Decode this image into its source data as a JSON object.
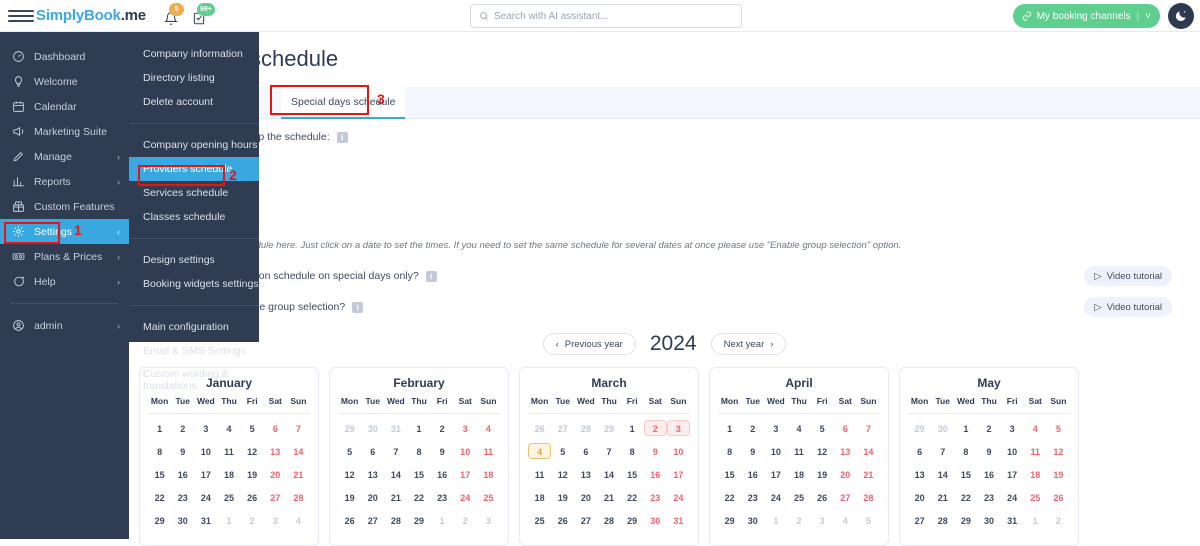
{
  "header": {
    "logo_simply": "S",
    "logo_mid": "implyBook",
    "logo_end": ".me",
    "menu_icon": "hamburger-icon",
    "bell_badge": "5",
    "tasks_badge": "99+",
    "search": {
      "placeholder": "Search with AI assistant...",
      "value": ""
    },
    "booking_channels_label": "My booking channels",
    "booking_channels_caret": "˅",
    "theme_toggle": "dark-mode-icon"
  },
  "sidebar": {
    "items": [
      {
        "label": "Dashboard",
        "icon": "dashboard-icon",
        "chevron": "",
        "active": false
      },
      {
        "label": "Welcome",
        "icon": "bulb-icon",
        "chevron": "",
        "active": false
      },
      {
        "label": "Calendar",
        "icon": "calendar-icon",
        "chevron": "",
        "active": false
      },
      {
        "label": "Marketing Suite",
        "icon": "megaphone-icon",
        "chevron": "",
        "active": false
      },
      {
        "label": "Manage",
        "icon": "pencil-icon",
        "chevron": "›",
        "active": false
      },
      {
        "label": "Reports",
        "icon": "chart-icon",
        "chevron": "›",
        "active": false
      },
      {
        "label": "Custom Features",
        "icon": "gift-icon",
        "chevron": "",
        "active": false
      },
      {
        "label": "Settings",
        "icon": "gear-icon",
        "chevron": "‹",
        "active": true
      },
      {
        "label": "Plans & Prices",
        "icon": "money-icon",
        "chevron": "›",
        "active": false
      },
      {
        "label": "Help",
        "icon": "chat-icon",
        "chevron": "›",
        "active": false
      }
    ],
    "account": {
      "label": "admin",
      "icon": "user-icon",
      "chevron": "›"
    }
  },
  "submenu": {
    "groups": [
      {
        "items": [
          {
            "label": "Company information",
            "highlight": false
          },
          {
            "label": "Directory listing",
            "highlight": false
          },
          {
            "label": "Delete account",
            "highlight": false
          }
        ]
      },
      {
        "items": [
          {
            "label": "Company opening hours",
            "highlight": false
          },
          {
            "label": "Providers schedule",
            "highlight": true
          },
          {
            "label": "Services schedule",
            "highlight": false
          },
          {
            "label": "Classes schedule",
            "highlight": false
          }
        ]
      },
      {
        "items": [
          {
            "label": "Design settings",
            "highlight": false
          },
          {
            "label": "Booking widgets settings",
            "highlight": false
          }
        ]
      },
      {
        "items": [
          {
            "label": "Main configuration",
            "highlight": false
          },
          {
            "label": "Email & SMS Settings",
            "highlight": false
          },
          {
            "label": "Custom wording & translations",
            "highlight": false
          }
        ]
      }
    ]
  },
  "markers": [
    {
      "number": "1",
      "target": "settings-sidebar-item"
    },
    {
      "number": "2",
      "target": "providers-schedule-menu-item"
    },
    {
      "number": "3",
      "target": "special-days-schedule-tab"
    }
  ],
  "main": {
    "page_title": "Providers schedule",
    "tab_label": "Special days schedule",
    "set_up_label": "Select provider to set up the schedule:",
    "info_glyph": "i",
    "note": "You can set special schedule here. Just click on a date to set the times. If you need to set the same schedule for several dates at once please use \"Enable group selection\" option.",
    "question_1": "Would you like to work on schedule on special days only?",
    "question_2": "Would you like to enable group selection?",
    "video_tutorial_label": "Video tutorial",
    "play_glyph": "▷",
    "prev_year_label": "Previous year",
    "next_year_label": "Next year",
    "prev_glyph": "‹",
    "next_glyph": "›",
    "year": "2024"
  },
  "calendar": {
    "dow": [
      "Mon",
      "Tue",
      "Wed",
      "Thu",
      "Fri",
      "Sat",
      "Sun"
    ],
    "months": [
      {
        "name": "January",
        "weeks": [
          [
            {
              "d": "1"
            },
            {
              "d": "2"
            },
            {
              "d": "3"
            },
            {
              "d": "4"
            },
            {
              "d": "5"
            },
            {
              "d": "6",
              "we": true
            },
            {
              "d": "7",
              "we": true
            }
          ],
          [
            {
              "d": "8"
            },
            {
              "d": "9"
            },
            {
              "d": "10"
            },
            {
              "d": "11"
            },
            {
              "d": "12"
            },
            {
              "d": "13",
              "we": true
            },
            {
              "d": "14",
              "we": true
            }
          ],
          [
            {
              "d": "15"
            },
            {
              "d": "16"
            },
            {
              "d": "17"
            },
            {
              "d": "18"
            },
            {
              "d": "19"
            },
            {
              "d": "20",
              "we": true
            },
            {
              "d": "21",
              "we": true
            }
          ],
          [
            {
              "d": "22"
            },
            {
              "d": "23"
            },
            {
              "d": "24"
            },
            {
              "d": "25"
            },
            {
              "d": "26"
            },
            {
              "d": "27",
              "we": true
            },
            {
              "d": "28",
              "we": true
            }
          ],
          [
            {
              "d": "29"
            },
            {
              "d": "30"
            },
            {
              "d": "31"
            },
            {
              "d": "1",
              "out": true
            },
            {
              "d": "2",
              "out": true
            },
            {
              "d": "3",
              "out": true
            },
            {
              "d": "4",
              "out": true
            }
          ]
        ]
      },
      {
        "name": "February",
        "weeks": [
          [
            {
              "d": "29",
              "out": true
            },
            {
              "d": "30",
              "out": true
            },
            {
              "d": "31",
              "out": true
            },
            {
              "d": "1"
            },
            {
              "d": "2"
            },
            {
              "d": "3",
              "we": true
            },
            {
              "d": "4",
              "we": true
            }
          ],
          [
            {
              "d": "5"
            },
            {
              "d": "6"
            },
            {
              "d": "7"
            },
            {
              "d": "8"
            },
            {
              "d": "9"
            },
            {
              "d": "10",
              "we": true
            },
            {
              "d": "11",
              "we": true
            }
          ],
          [
            {
              "d": "12"
            },
            {
              "d": "13"
            },
            {
              "d": "14"
            },
            {
              "d": "15"
            },
            {
              "d": "16"
            },
            {
              "d": "17",
              "we": true
            },
            {
              "d": "18",
              "we": true
            }
          ],
          [
            {
              "d": "19"
            },
            {
              "d": "20"
            },
            {
              "d": "21"
            },
            {
              "d": "22"
            },
            {
              "d": "23"
            },
            {
              "d": "24",
              "we": true
            },
            {
              "d": "25",
              "we": true
            }
          ],
          [
            {
              "d": "26"
            },
            {
              "d": "27"
            },
            {
              "d": "28"
            },
            {
              "d": "29"
            },
            {
              "d": "1",
              "out": true
            },
            {
              "d": "2",
              "out": true
            },
            {
              "d": "3",
              "out": true
            }
          ]
        ]
      },
      {
        "name": "March",
        "weeks": [
          [
            {
              "d": "26",
              "out": true
            },
            {
              "d": "27",
              "out": true
            },
            {
              "d": "28",
              "out": true
            },
            {
              "d": "29",
              "out": true
            },
            {
              "d": "1"
            },
            {
              "d": "2",
              "we": true,
              "mark": "red"
            },
            {
              "d": "3",
              "we": true,
              "mark": "red"
            }
          ],
          [
            {
              "d": "4",
              "mark": "orange"
            },
            {
              "d": "5"
            },
            {
              "d": "6"
            },
            {
              "d": "7"
            },
            {
              "d": "8"
            },
            {
              "d": "9",
              "we": true
            },
            {
              "d": "10",
              "we": true
            }
          ],
          [
            {
              "d": "11"
            },
            {
              "d": "12"
            },
            {
              "d": "13"
            },
            {
              "d": "14"
            },
            {
              "d": "15"
            },
            {
              "d": "16",
              "we": true
            },
            {
              "d": "17",
              "we": true
            }
          ],
          [
            {
              "d": "18"
            },
            {
              "d": "19"
            },
            {
              "d": "20"
            },
            {
              "d": "21"
            },
            {
              "d": "22"
            },
            {
              "d": "23",
              "we": true
            },
            {
              "d": "24",
              "we": true
            }
          ],
          [
            {
              "d": "25"
            },
            {
              "d": "26"
            },
            {
              "d": "27"
            },
            {
              "d": "28"
            },
            {
              "d": "29"
            },
            {
              "d": "30",
              "we": true
            },
            {
              "d": "31",
              "we": true
            }
          ]
        ]
      },
      {
        "name": "April",
        "weeks": [
          [
            {
              "d": "1"
            },
            {
              "d": "2"
            },
            {
              "d": "3"
            },
            {
              "d": "4"
            },
            {
              "d": "5"
            },
            {
              "d": "6",
              "we": true
            },
            {
              "d": "7",
              "we": true
            }
          ],
          [
            {
              "d": "8"
            },
            {
              "d": "9"
            },
            {
              "d": "10"
            },
            {
              "d": "11"
            },
            {
              "d": "12"
            },
            {
              "d": "13",
              "we": true
            },
            {
              "d": "14",
              "we": true
            }
          ],
          [
            {
              "d": "15"
            },
            {
              "d": "16"
            },
            {
              "d": "17"
            },
            {
              "d": "18"
            },
            {
              "d": "19"
            },
            {
              "d": "20",
              "we": true
            },
            {
              "d": "21",
              "we": true
            }
          ],
          [
            {
              "d": "22"
            },
            {
              "d": "23"
            },
            {
              "d": "24"
            },
            {
              "d": "25"
            },
            {
              "d": "26"
            },
            {
              "d": "27",
              "we": true
            },
            {
              "d": "28",
              "we": true
            }
          ],
          [
            {
              "d": "29"
            },
            {
              "d": "30"
            },
            {
              "d": "1",
              "out": true
            },
            {
              "d": "2",
              "out": true
            },
            {
              "d": "3",
              "out": true
            },
            {
              "d": "4",
              "out": true
            },
            {
              "d": "5",
              "out": true
            }
          ]
        ]
      },
      {
        "name": "May",
        "weeks": [
          [
            {
              "d": "29",
              "out": true
            },
            {
              "d": "30",
              "out": true
            },
            {
              "d": "1"
            },
            {
              "d": "2"
            },
            {
              "d": "3"
            },
            {
              "d": "4",
              "we": true
            },
            {
              "d": "5",
              "we": true
            }
          ],
          [
            {
              "d": "6"
            },
            {
              "d": "7"
            },
            {
              "d": "8"
            },
            {
              "d": "9"
            },
            {
              "d": "10"
            },
            {
              "d": "11",
              "we": true
            },
            {
              "d": "12",
              "we": true
            }
          ],
          [
            {
              "d": "13"
            },
            {
              "d": "14"
            },
            {
              "d": "15"
            },
            {
              "d": "16"
            },
            {
              "d": "17"
            },
            {
              "d": "18",
              "we": true
            },
            {
              "d": "19",
              "we": true
            }
          ],
          [
            {
              "d": "20"
            },
            {
              "d": "21"
            },
            {
              "d": "22"
            },
            {
              "d": "23"
            },
            {
              "d": "24"
            },
            {
              "d": "25",
              "we": true
            },
            {
              "d": "26",
              "we": true
            }
          ],
          [
            {
              "d": "27"
            },
            {
              "d": "28"
            },
            {
              "d": "29"
            },
            {
              "d": "30"
            },
            {
              "d": "31"
            },
            {
              "d": "1",
              "out": true
            },
            {
              "d": "2",
              "out": true
            }
          ]
        ]
      }
    ]
  },
  "colors": {
    "sidebar_bg": "#303c52",
    "accent_blue": "#3aa8e0",
    "green": "#5ecf8e",
    "weekend_red": "#f4616b",
    "marker_red": "#e8140f",
    "orange_badge": "#f0ad4e"
  }
}
